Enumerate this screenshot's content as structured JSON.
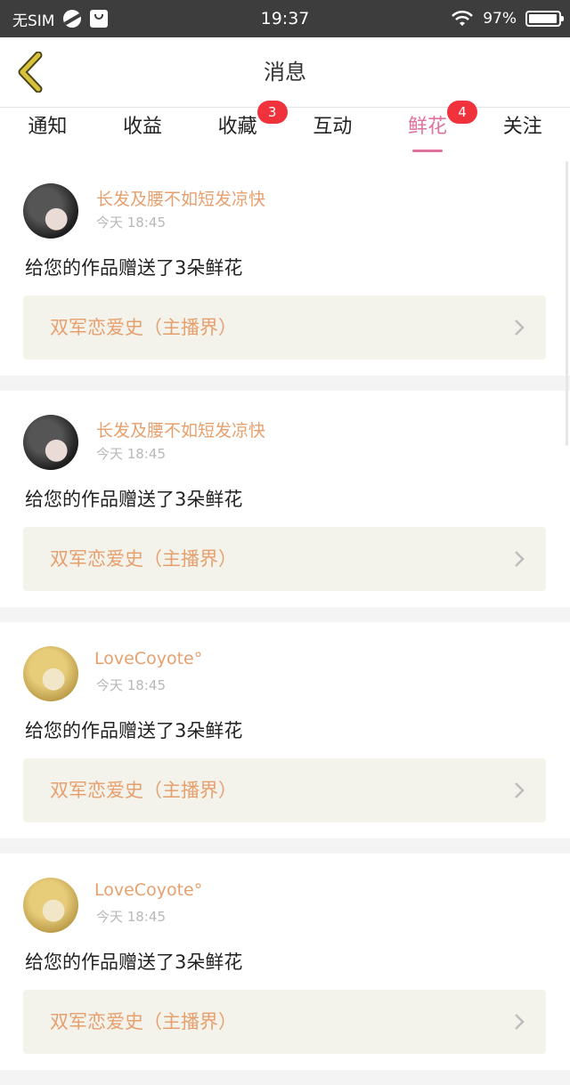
{
  "status_bar": {
    "carrier": "无SIM",
    "time": "19:37",
    "battery": "97%",
    "battery_level": 0.97,
    "icons": [
      "moon-icon",
      "bag-icon",
      "wifi-icon",
      "battery-icon"
    ]
  },
  "header": {
    "title": "消息",
    "back_icon": "chevron-left-icon",
    "accent_color": "#d8c23a"
  },
  "tabs": [
    {
      "label": "通知",
      "badge": ""
    },
    {
      "label": "收益",
      "badge": ""
    },
    {
      "label": "收藏",
      "badge": "3"
    },
    {
      "label": "互动",
      "badge": ""
    },
    {
      "label": "鲜花",
      "badge": "4",
      "active": true
    },
    {
      "label": "关注",
      "badge": ""
    }
  ],
  "colors": {
    "active_tab": "#e0709d",
    "badge": "#f0323c",
    "username": "#e6a06e",
    "work_box_bg": "#f3f2eb"
  },
  "messages": [
    {
      "username": "长发及腰不如短发凉快",
      "time": "今天 18:45",
      "text": "给您的作品赠送了3朵鲜花",
      "work_title": "双军恋爱史（主播界）"
    },
    {
      "username": "长发及腰不如短发凉快",
      "time": "今天 18:45",
      "text": "给您的作品赠送了3朵鲜花",
      "work_title": "双军恋爱史（主播界）"
    },
    {
      "username": "LoveCoyote°",
      "time": "今天 18:45",
      "text": "给您的作品赠送了3朵鲜花",
      "work_title": "双军恋爱史（主播界）"
    },
    {
      "username": "LoveCoyote°",
      "time": "今天 18:45",
      "text": "给您的作品赠送了3朵鲜花",
      "work_title": "双军恋爱史（主播界）"
    }
  ]
}
